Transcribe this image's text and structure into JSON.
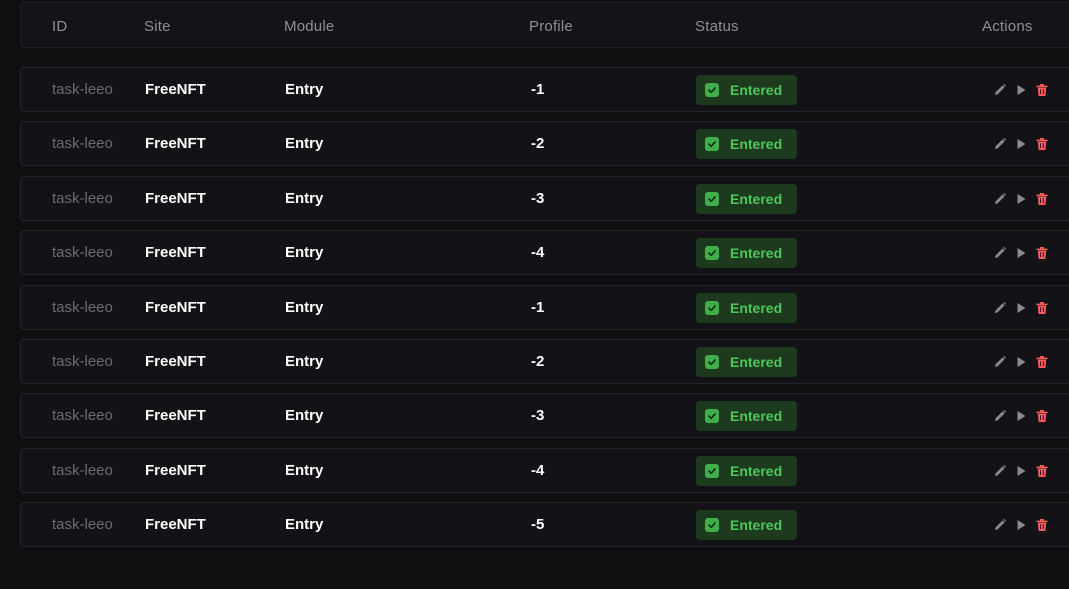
{
  "columns": {
    "id": "ID",
    "site": "Site",
    "module": "Module",
    "profile": "Profile",
    "status": "Status",
    "actions": "Actions"
  },
  "colors": {
    "background": "#0f0f12",
    "row": "#131317",
    "status_bg": "#1d3a1f",
    "status_text": "#4cc95a",
    "delete": "#ff5c5c",
    "muted_icon": "#8a8a90"
  },
  "icons": {
    "status": "check-icon",
    "edit": "pencil-icon",
    "start": "play-icon",
    "delete": "trash-icon"
  },
  "rows": [
    {
      "id": "task-leeo",
      "site": "FreeNFT",
      "module": "Entry",
      "profile": "-1",
      "status": "Entered"
    },
    {
      "id": "task-leeo",
      "site": "FreeNFT",
      "module": "Entry",
      "profile": "-2",
      "status": "Entered"
    },
    {
      "id": "task-leeo",
      "site": "FreeNFT",
      "module": "Entry",
      "profile": "-3",
      "status": "Entered"
    },
    {
      "id": "task-leeo",
      "site": "FreeNFT",
      "module": "Entry",
      "profile": "-4",
      "status": "Entered"
    },
    {
      "id": "task-leeo",
      "site": "FreeNFT",
      "module": "Entry",
      "profile": "-1",
      "status": "Entered"
    },
    {
      "id": "task-leeo",
      "site": "FreeNFT",
      "module": "Entry",
      "profile": "-2",
      "status": "Entered"
    },
    {
      "id": "task-leeo",
      "site": "FreeNFT",
      "module": "Entry",
      "profile": "-3",
      "status": "Entered"
    },
    {
      "id": "task-leeo",
      "site": "FreeNFT",
      "module": "Entry",
      "profile": "-4",
      "status": "Entered"
    },
    {
      "id": "task-leeo",
      "site": "FreeNFT",
      "module": "Entry",
      "profile": "-5",
      "status": "Entered"
    }
  ]
}
